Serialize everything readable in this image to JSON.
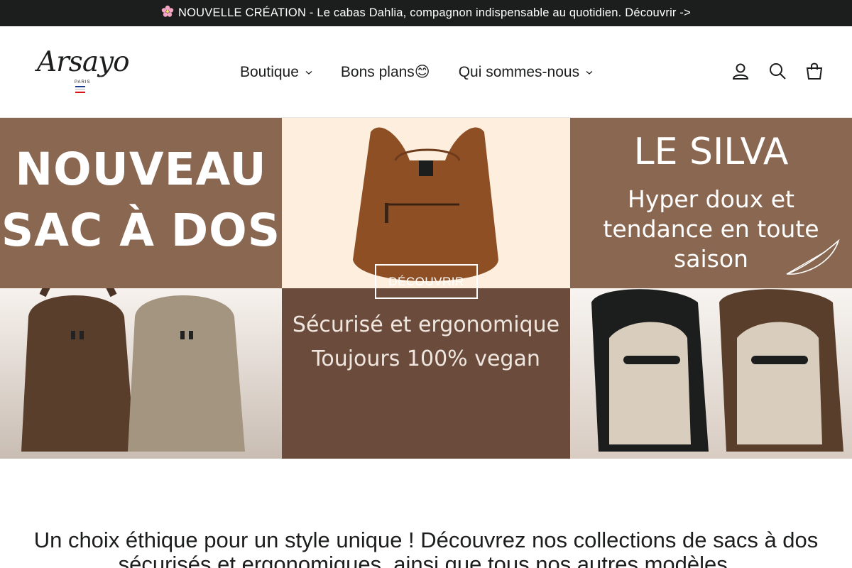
{
  "announcement": {
    "icon": "cherry-blossom-icon",
    "text": "NOUVELLE CRÉATION - Le cabas Dahlia, compagnon indispensable au quotidien. Découvrir ->"
  },
  "brand": {
    "logo_text": "Arsayo",
    "logo_sub": "PARIS",
    "flag_colors": [
      "#1c3d8f",
      "#ffffff",
      "#d9141a"
    ]
  },
  "nav": {
    "items": [
      {
        "label": "Boutique",
        "has_dropdown": true
      },
      {
        "label": "Bons plans😊",
        "has_dropdown": false
      },
      {
        "label": "Qui sommes-nous",
        "has_dropdown": true
      }
    ]
  },
  "header_icons": [
    "account-icon",
    "search-icon",
    "cart-icon"
  ],
  "hero": {
    "left_title_line1": "NOUVEAU",
    "left_title_line2": "SAC À DOS",
    "mid_line1": "Sécurisé et ergonomique",
    "mid_line2": "Toujours 100% vegan",
    "cta_label": "DÉCOUVRIR",
    "right_title": "LE SILVA",
    "right_line1": "Hyper doux et",
    "right_line2": "tendance en toute",
    "right_line3": "saison",
    "colors": {
      "panel_brown": "#8a6751",
      "panel_cream": "#fdeedd",
      "panel_dark": "#6b4c3c"
    }
  },
  "intro": {
    "line1": "Un choix éthique pour un style unique ! Découvrez nos collections de sacs à dos",
    "line2": "sécurisés et ergonomiques, ainsi que tous nos autres modèles."
  }
}
